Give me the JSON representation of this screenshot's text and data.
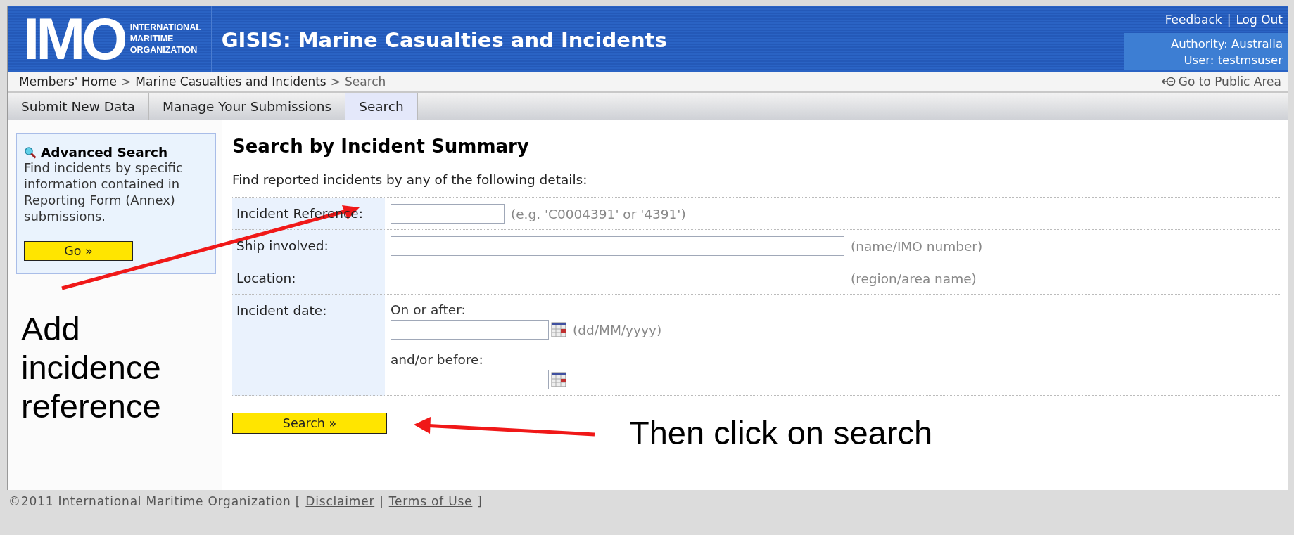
{
  "header": {
    "logo": {
      "letters": "IMO",
      "org_lines": [
        "INTERNATIONAL",
        "MARITIME",
        "ORGANIZATION"
      ]
    },
    "title": "GISIS: Marine Casualties and Incidents",
    "links": [
      {
        "label": "Feedback"
      },
      {
        "separator": "|",
        "label": "Log Out"
      }
    ],
    "authority": "Authority: Australia",
    "user": "User: testmsuser"
  },
  "breadcrumb": {
    "items": [
      {
        "label": "Members' Home"
      },
      {
        "separator": ">",
        "label": "Marine Casualties and Incidents"
      },
      {
        "separator": ">",
        "label": "Search",
        "current": true
      }
    ],
    "public_link": "Go to Public Area"
  },
  "tabs": [
    {
      "label": "Submit New Data",
      "selected": false
    },
    {
      "label": "Manage Your Submissions",
      "selected": false
    },
    {
      "label": "Search",
      "selected": true
    }
  ],
  "sidebar": {
    "title": "Advanced Search",
    "text": "Find incidents by specific information contained in Reporting Form (Annex) submissions.",
    "button": "Go »"
  },
  "form": {
    "heading": "Search by Incident Summary",
    "intro": "Find reported incidents by any of the following details:",
    "rows": [
      {
        "kind": "short",
        "label": "Incident Reference:",
        "hint": "(e.g. 'C0004391' or '4391')"
      },
      {
        "kind": "long",
        "label": "Ship involved:",
        "hint": "(name/IMO number)"
      },
      {
        "kind": "long",
        "label": "Location:",
        "hint": "(region/area name)"
      },
      {
        "kind": "dates",
        "label": "Incident date:",
        "after_label": "On or after:",
        "after_hint": "(dd/MM/yyyy)",
        "before_label": "and/or before:"
      }
    ],
    "button": "Search »"
  },
  "annotations": [
    "Add incidence reference",
    "Then click on search"
  ],
  "footer": {
    "copyright": "©2011 International Maritime Organization [",
    "links": [
      {
        "label": "Disclaimer"
      },
      {
        "separator": "|",
        "label": "Terms of Use"
      }
    ],
    "close": "]"
  }
}
